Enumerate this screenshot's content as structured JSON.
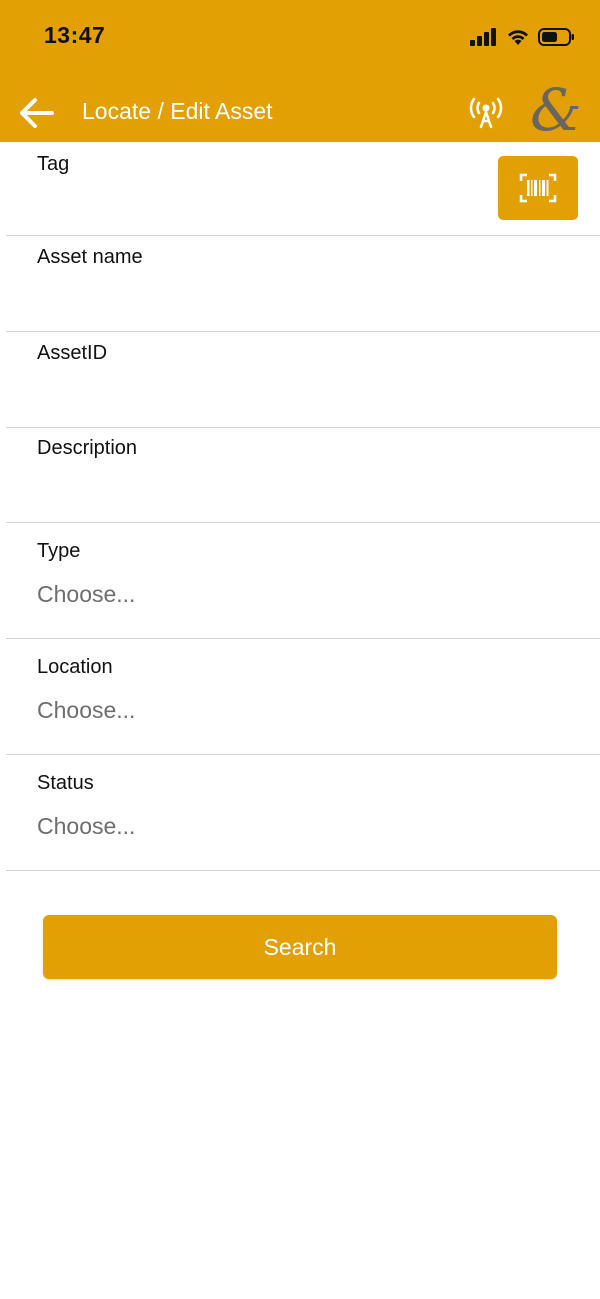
{
  "status_bar": {
    "time": "13:47",
    "icons": [
      "signal-icon",
      "wifi-icon",
      "battery-icon"
    ]
  },
  "nav": {
    "back_icon": "arrow-left-icon",
    "title": "Locate / Edit Asset",
    "antenna_icon": "antenna-icon",
    "logo_glyph": "&"
  },
  "form": {
    "tag": {
      "label": "Tag",
      "value": "",
      "scan_icon": "barcode-scan-icon"
    },
    "asset_name": {
      "label": "Asset name",
      "value": ""
    },
    "asset_id": {
      "label": "AssetID",
      "value": ""
    },
    "description": {
      "label": "Description",
      "value": ""
    },
    "type": {
      "label": "Type",
      "selected": "Choose..."
    },
    "location": {
      "label": "Location",
      "selected": "Choose..."
    },
    "status": {
      "label": "Status",
      "selected": "Choose..."
    }
  },
  "actions": {
    "search_label": "Search"
  },
  "colors": {
    "accent": "#e3a005",
    "text": "#111111",
    "placeholder": "#6e6e6e",
    "divider": "#d2d2d2",
    "logo": "#6b6560"
  }
}
